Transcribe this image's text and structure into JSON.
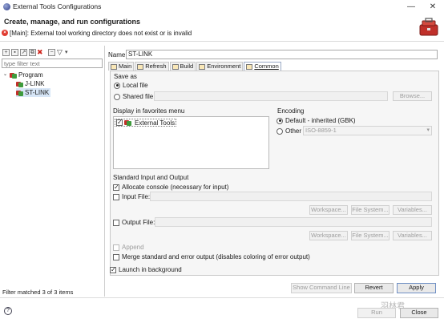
{
  "window": {
    "title": "External Tools Configurations",
    "minimize": "—",
    "maximize": "□",
    "close": "✕"
  },
  "header": {
    "title": "Create, manage, and run configurations",
    "error_message": "[Main]: External tool working directory does not exist or is invalid"
  },
  "left": {
    "filter_placeholder": "type filter text",
    "tree": {
      "category": "Program",
      "items": [
        "J-LINK",
        "ST-LINK"
      ],
      "selected": "ST-LINK"
    },
    "status": "Filter matched 3 of 3 items"
  },
  "config": {
    "name_label": "Name:",
    "name_value": "ST-LINK",
    "tabs": [
      "Main",
      "Refresh",
      "Build",
      "Environment",
      "Common"
    ],
    "active_tab": "Common"
  },
  "common": {
    "save_as": {
      "label": "Save as",
      "local_file": "Local file",
      "shared_file": "Shared file:",
      "browse": "Browse..."
    },
    "favorites": {
      "label": "Display in favorites menu",
      "item": "External Tools"
    },
    "encoding": {
      "label": "Encoding",
      "default": "Default - inherited (GBK)",
      "other": "Other",
      "other_value": "ISO-8859-1"
    },
    "stdio": {
      "label": "Standard Input and Output",
      "allocate_console": "Allocate console (necessary for input)",
      "input_file": "Input File:",
      "output_file": "Output File:",
      "workspace": "Workspace...",
      "file_system": "File System...",
      "variables": "Variables...",
      "append": "Append",
      "merge": "Merge standard and error output (disables coloring of error output)"
    },
    "launch_background": "Launch in background"
  },
  "buttons": {
    "show_command_line": "Show Command Line",
    "revert": "Revert",
    "apply": "Apply",
    "run": "Run",
    "close": "Close"
  },
  "watermark": "羽林君",
  "colors": {
    "selection": "#d7e6f7",
    "error": "#e03a2f"
  }
}
